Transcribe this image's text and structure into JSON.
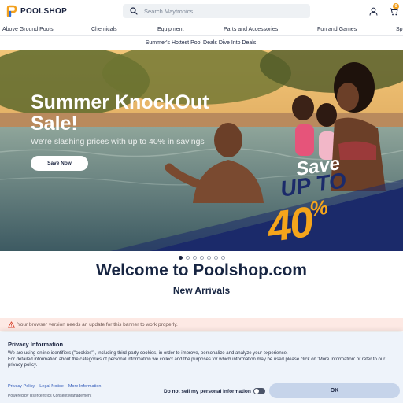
{
  "header": {
    "logo_text": "POOLSHOP",
    "search_placeholder": "Search Maytronics...",
    "cart_count": "0"
  },
  "nav": {
    "items": [
      {
        "label": "Above Ground Pools"
      },
      {
        "label": "Chemicals"
      },
      {
        "label": "Equipment"
      },
      {
        "label": "Parts and Accessories"
      },
      {
        "label": "Fun and Games"
      },
      {
        "label": "Sp"
      }
    ]
  },
  "promo": {
    "text": "Summer's Hottest Pool Deals Dive Into Deals!"
  },
  "hero": {
    "title": "Summer KnockOut Sale!",
    "subtitle": "We're slashing prices with up to 40% in savings",
    "button_label": "Save Now",
    "badge_save": "Save",
    "badge_upto": "UP TO",
    "badge_percent": "40",
    "badge_percent_sign": "%",
    "carousel_slides": 7,
    "active_slide": 1
  },
  "main": {
    "welcome": "Welcome to Poolshop.com",
    "section_title": "New Arrivals"
  },
  "browser_warning": {
    "text": "Your browser version needs an update for this banner to work properly."
  },
  "privacy": {
    "title": "Privacy Information",
    "body_line1": "We are using online identifiers (\"cookies\"), including third-party cookies, in order to improve, personalize and analyze your experience.",
    "body_line2": "For detailed information about the categories of personal information we collect and the purposes for which information may be used please click on 'More Information' or refer to our privacy policy.",
    "links": [
      {
        "label": "Privacy Policy"
      },
      {
        "label": "Legal Notice"
      },
      {
        "label": "More Information"
      }
    ],
    "powered_by": "Powered by Usercentrics Consent Management",
    "do_not_sell_label": "Do not sell my personal information",
    "ok_label": "OK"
  },
  "colors": {
    "brand_navy": "#1b2440",
    "accent_orange": "#f5a51b",
    "warning_bg": "#fde9e4",
    "privacy_bg": "#eef3fa",
    "ok_button": "#c6d4ea"
  }
}
